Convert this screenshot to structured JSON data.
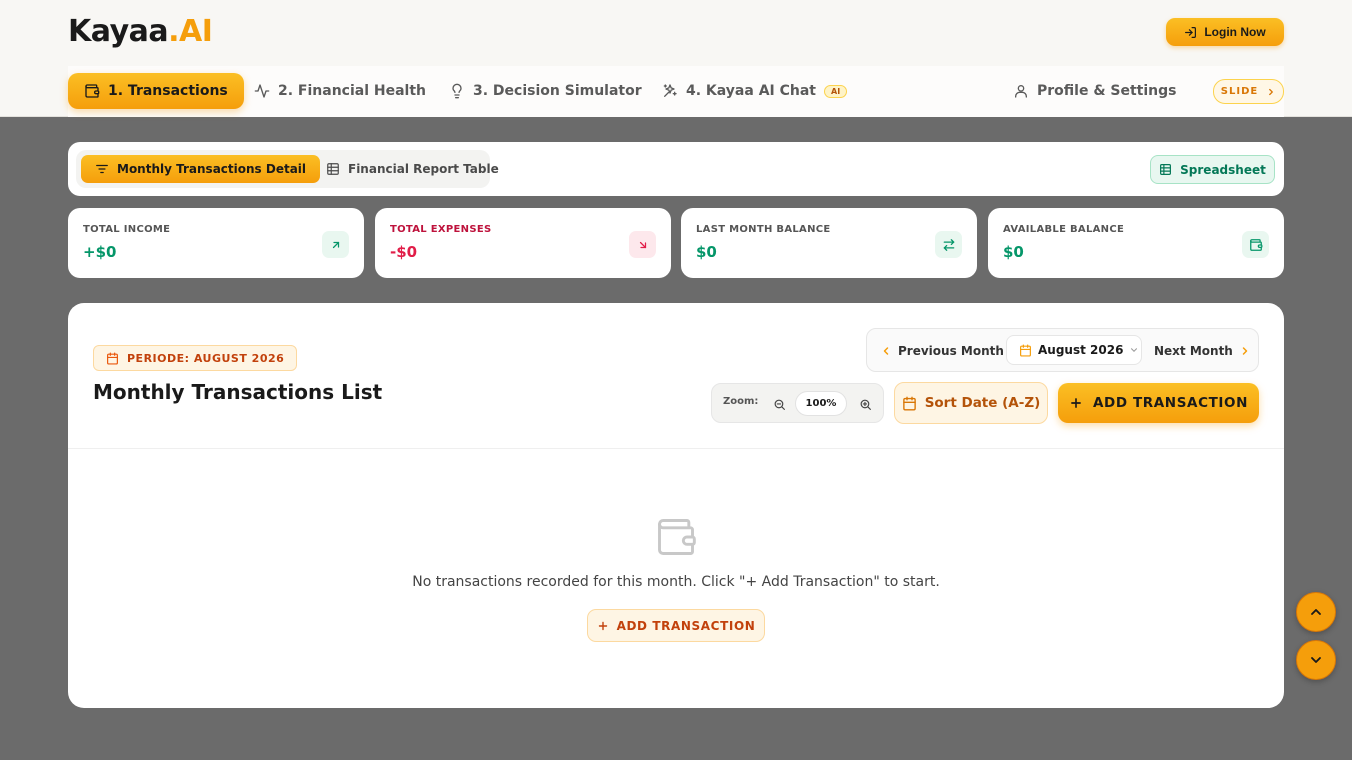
{
  "app": {
    "logo_main": "Kayaa",
    "logo_accent": ".AI",
    "login_label": "Login Now"
  },
  "nav": {
    "items": [
      {
        "label": "1. Transactions",
        "icon": "wallet-icon",
        "active": true
      },
      {
        "label": "2. Financial Health",
        "icon": "activity-icon"
      },
      {
        "label": "3. Decision Simulator",
        "icon": "lightbulb-icon"
      },
      {
        "label": "4. Kayaa AI Chat",
        "icon": "sparkles-icon",
        "badge": "AI"
      },
      {
        "label": "Profile & Settings",
        "icon": "user-icon"
      }
    ],
    "slide_label": "SLIDE"
  },
  "toolbar": {
    "views": [
      {
        "label": "Monthly Transactions Detail",
        "icon": "filter-icon",
        "active": true
      },
      {
        "label": "Financial Report Table",
        "icon": "table-icon"
      }
    ],
    "spreadsheet_label": "Spreadsheet"
  },
  "stats": [
    {
      "label": "TOTAL INCOME",
      "value": "+$0",
      "icon": "arrow-up-right-icon",
      "color": "#059669"
    },
    {
      "label": "TOTAL EXPENSES",
      "value": "-$0",
      "icon": "arrow-down-right-icon",
      "color": "#e11d48"
    },
    {
      "label": "LAST MONTH BALANCE",
      "value": "$0",
      "icon": "swap-icon",
      "color": "#059669"
    },
    {
      "label": "AVAILABLE BALANCE",
      "value": "$0",
      "icon": "wallet-icon",
      "color": "#059669"
    }
  ],
  "panel": {
    "period_label": "PERIODE: AUGUST 2026",
    "title": "Monthly Transactions List",
    "prev_label": "Previous Month",
    "month_value": "August 2026",
    "next_label": "Next Month",
    "zoom_label": "Zoom:",
    "zoom_value": "100%",
    "sort_label": "Sort Date (A-Z)",
    "add_label": "ADD TRANSACTION",
    "empty_text": "No transactions recorded for this month. Click \"+ Add Transaction\" to start.",
    "empty_add_label": "ADD TRANSACTION"
  },
  "colors": {
    "accent": "#f59e0b",
    "income": "#059669",
    "expense": "#e11d48"
  }
}
